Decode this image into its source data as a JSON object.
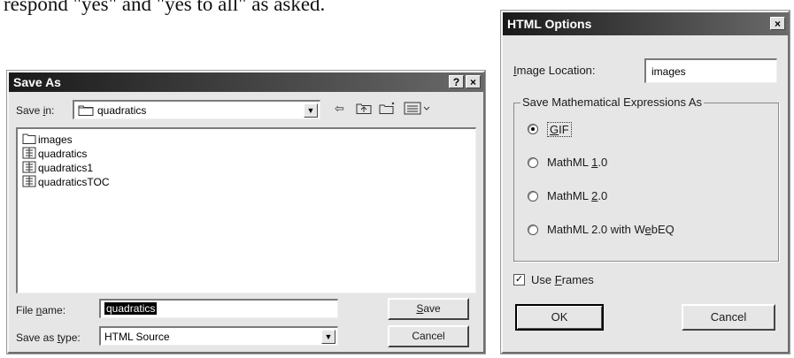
{
  "doc": {
    "text": "respond \"yes\" and \"yes to all\" as asked."
  },
  "save_as": {
    "title": "Save As",
    "help": "?",
    "close": "×",
    "save_in_label_pre": "Save ",
    "save_in_label_u": "i",
    "save_in_label_post": "n:",
    "save_in_value": "quadratics",
    "files": [
      {
        "name": "images",
        "icon": "folder-icon"
      },
      {
        "name": "quadratics",
        "icon": "document-icon"
      },
      {
        "name": "quadratics1",
        "icon": "document-icon"
      },
      {
        "name": "quadraticsTOC",
        "icon": "document-icon"
      }
    ],
    "file_name_label_pre": "File ",
    "file_name_label_u": "n",
    "file_name_label_post": "ame:",
    "file_name_value": "quadratics",
    "save_type_label_pre": "Save as ",
    "save_type_label_u": "t",
    "save_type_label_post": "ype:",
    "save_type_value": "HTML Source",
    "save_btn_u": "S",
    "save_btn_rest": "ave",
    "cancel_btn": "Cancel"
  },
  "html_options": {
    "title": "HTML Options",
    "close": "×",
    "image_loc_label_u": "I",
    "image_loc_label_rest": "mage Location:",
    "image_loc_value": "images",
    "group_title": "Save Mathematical Expressions As",
    "options": [
      {
        "pre": "",
        "u": "G",
        "post": "IF",
        "selected": true
      },
      {
        "pre": "MathML ",
        "u": "1",
        "post": ".0",
        "selected": false
      },
      {
        "pre": "MathML ",
        "u": "2",
        "post": ".0",
        "selected": false
      },
      {
        "pre": "MathML 2.0 with W",
        "u": "e",
        "post": "bEQ",
        "selected": false
      }
    ],
    "use_frames_pre": "Use ",
    "use_frames_u": "F",
    "use_frames_post": "rames",
    "use_frames_checked": true,
    "ok_btn": "OK",
    "cancel_btn": "Cancel"
  },
  "colors": {
    "titlebar_dark": "#1a1a1a",
    "dialog_bg": "#e6e6e6",
    "selection": "#000000"
  }
}
